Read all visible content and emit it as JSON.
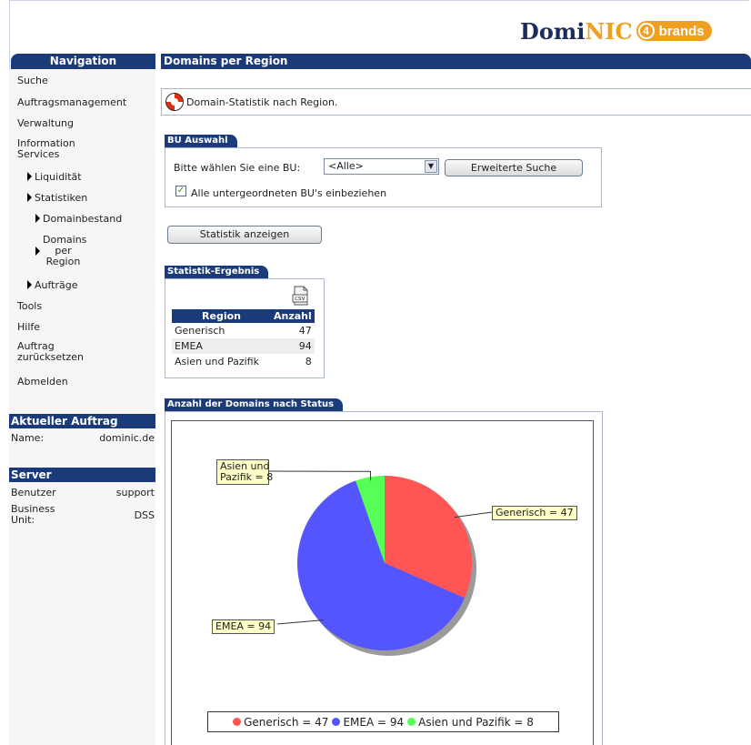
{
  "header": {
    "top_text": "...",
    "logo": {
      "part1": "Domi",
      "part2": "NIC",
      "badge_num": "4",
      "badge_text": "brands"
    }
  },
  "navigation": {
    "title": "Navigation",
    "items": [
      {
        "label": "Suche"
      },
      {
        "label": "Auftragsmanagement"
      },
      {
        "label": "Verwaltung"
      },
      {
        "label": "Information Services"
      }
    ],
    "sub1": [
      "Liquidität",
      "Statistiken"
    ],
    "sub2": [
      "Domainbestand",
      "Domains per Region"
    ],
    "sub1b": "Aufträge",
    "items2": [
      "Tools",
      "Hilfe",
      "Auftrag zurücksetzen",
      "Abmelden"
    ]
  },
  "current_order": {
    "title": "Aktueller Auftrag",
    "name_label": "Name:",
    "name_value": "dominic.de"
  },
  "server": {
    "title": "Server",
    "user_label": "Benutzer",
    "user_value": "support",
    "bu_label": "Business Unit:",
    "bu_value": "DSS"
  },
  "main": {
    "title": "Domains per Region",
    "info": "Domain-Statistik nach Region.",
    "bu_section": {
      "tab": "BU Auswahl",
      "prompt": "Bitte wählen Sie eine BU:",
      "select_value": "<Alle>",
      "ext_search": "Erweiterte Suche",
      "checkbox_label": "Alle untergeordneten BU's einbeziehen",
      "checked": true
    },
    "show_button": "Statistik anzeigen",
    "result": {
      "tab": "Statistik-Ergebnis",
      "csv_icon_label": "csv",
      "headers": [
        "Region",
        "Anzahl"
      ],
      "rows": [
        {
          "region": "Generisch",
          "count": "47"
        },
        {
          "region": "EMEA",
          "count": "94"
        },
        {
          "region": "Asien und Pazifik",
          "count": "8"
        }
      ]
    },
    "chart_tab": "Anzahl der Domains nach Status"
  },
  "chart_data": {
    "type": "pie",
    "title": "",
    "slices": [
      {
        "label": "Generisch",
        "value": 47,
        "color": "#ff5555",
        "callout": "Generisch = 47"
      },
      {
        "label": "EMEA",
        "value": 94,
        "color": "#5555ff",
        "callout": "EMEA = 94"
      },
      {
        "label": "Asien und Pazifik",
        "value": 8,
        "color": "#55ff55",
        "callout": "Asien und\nPazifik = 8"
      }
    ],
    "legend": [
      "Generisch = 47",
      "EMEA = 94",
      "Asien und Pazifik = 8"
    ],
    "legend_position": "bottom"
  }
}
